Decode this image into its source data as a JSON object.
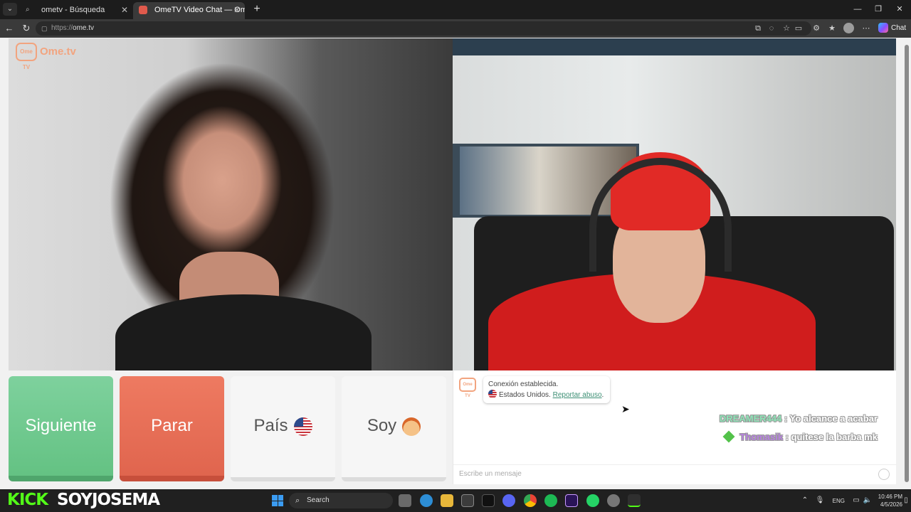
{
  "browser": {
    "tabs": [
      {
        "label": "ometv - Búsqueda",
        "active": false
      },
      {
        "label": "OmeTV Video Chat — Omegl",
        "active": true
      }
    ],
    "new_tab": "+",
    "url_scheme": "https://",
    "url_host": "ome.tv",
    "copilot_label": "Chat",
    "window_controls": [
      "—",
      "❐",
      "✕"
    ]
  },
  "page": {
    "logo_badge": "Ome TV",
    "logo_text": "Ome.tv",
    "buttons": {
      "next": "Siguiente",
      "stop": "Parar",
      "country": "País",
      "gender": "Soy"
    },
    "chat": {
      "avatar": "Ome TV",
      "system_line1": "Conexión establecida.",
      "system_country": "Estados Unidos.",
      "report_link": "Reportar abuso",
      "overlay_messages": [
        {
          "user": "DREAMER444",
          "text": ": Yo alcance a acabar"
        },
        {
          "user": "Thomasik",
          "text": ": quitese la barba mk"
        }
      ],
      "input_placeholder": "Escribe un mensaje"
    }
  },
  "stream": {
    "platform": "KICK",
    "username": "SOYJOSEMA"
  },
  "taskbar": {
    "search_placeholder": "Search",
    "language": "ENG",
    "time": "10:46 PM",
    "date": "4/5/2026"
  },
  "colors": {
    "next_green": "#6ec98c",
    "stop_red": "#e66d55",
    "kick_green": "#53fc18",
    "ome_orange": "#f2a47f"
  }
}
